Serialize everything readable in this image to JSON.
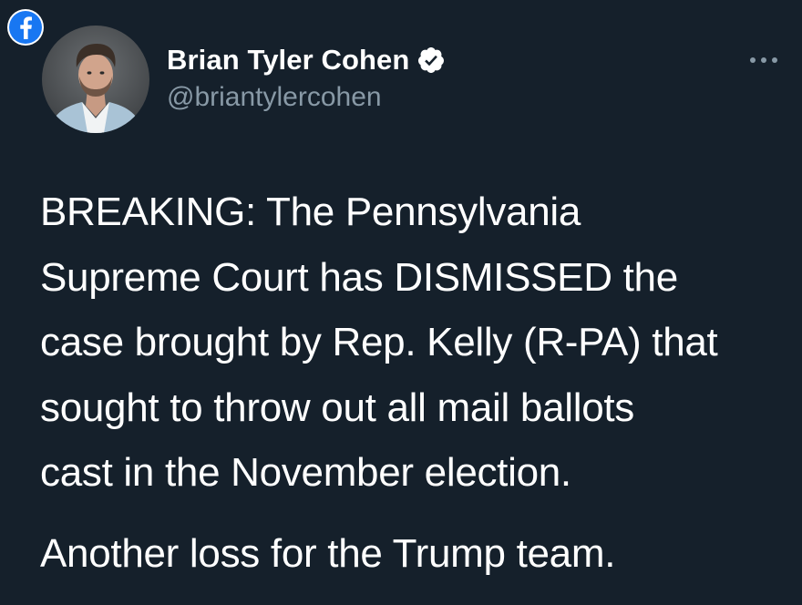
{
  "source_badge": {
    "icon": "facebook-icon",
    "color": "#1877f2"
  },
  "author": {
    "name": "Brian Tyler Cohen",
    "handle": "@briantylercohen",
    "verified": true,
    "verified_icon": "verified-badge-icon"
  },
  "menu": {
    "icon": "more-options-icon"
  },
  "tweet": {
    "lines": [
      "BREAKING: The Pennsylvania",
      "Supreme Court has DISMISSED the",
      "case brought by Rep. Kelly (R-PA) that",
      "sought to throw out all mail ballots",
      "cast in the November election."
    ],
    "paragraph_2": "Another loss for the Trump team."
  },
  "colors": {
    "background": "#15202b",
    "text": "#ffffff",
    "secondary_text": "#8899a6",
    "facebook_blue": "#1877f2"
  }
}
